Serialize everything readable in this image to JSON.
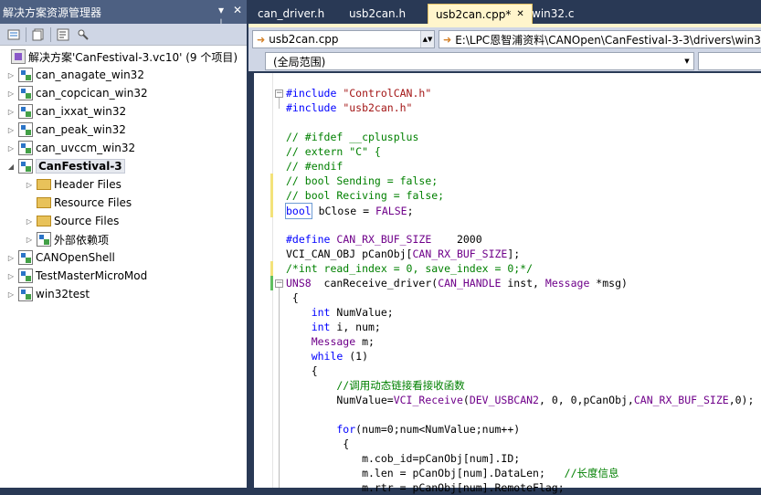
{
  "colors": {
    "accent_tab": "#fff5cc",
    "chrome_dark": "#293955",
    "title_bar": "#4d6082",
    "toolbar": "#cfd6e5",
    "change_yellow": "#f3e27a",
    "change_green": "#5fbf5f"
  },
  "solution_explorer": {
    "title": "解决方案资源管理器",
    "pin_label": "▾ ⊥",
    "close_label": "✕",
    "toolbar_icons": [
      "properties-icon",
      "show-all-files-icon",
      "view-code-icon",
      "class-diagram-icon"
    ],
    "solution_label": "解决方案'CanFestival-3.vc10' (9 个项目)",
    "items": [
      {
        "label": "can_anagate_win32",
        "icon": "project-icon"
      },
      {
        "label": "can_copcican_win32",
        "icon": "project-icon"
      },
      {
        "label": "can_ixxat_win32",
        "icon": "project-icon"
      },
      {
        "label": "can_peak_win32",
        "icon": "project-icon"
      },
      {
        "label": "can_uvccm_win32",
        "icon": "project-icon"
      },
      {
        "label": "CanFestival-3",
        "icon": "project-icon"
      },
      {
        "label": "Header Files",
        "icon": "folder-icon"
      },
      {
        "label": "Resource Files",
        "icon": "folder-icon"
      },
      {
        "label": "Source Files",
        "icon": "folder-icon"
      },
      {
        "label": "外部依赖项",
        "icon": "external-deps-icon"
      },
      {
        "label": "CANOpenShell",
        "icon": "project-icon"
      },
      {
        "label": "TestMasterMicroMod",
        "icon": "project-icon"
      },
      {
        "label": "win32test",
        "icon": "project-icon"
      }
    ]
  },
  "tabs": [
    {
      "label": "can_driver.h"
    },
    {
      "label": "usb2can.h"
    },
    {
      "label": "usb2can.cpp*",
      "close": "✕"
    },
    {
      "label": "win32.c"
    }
  ],
  "nav": {
    "file_combo": "usb2can.cpp",
    "path": "E:\\LPC恩智浦资料\\CANOpen\\CanFestival-3-3\\drivers\\win3",
    "scope": "(全局范围)"
  },
  "code": {
    "l1_kw": "#include",
    "l1_str": " \"ControlCAN.h\"",
    "l2_kw": "#include",
    "l2_str": " \"usb2can.h\"",
    "l4": "// #ifdef __cplusplus",
    "l5": "// extern \"C\" {",
    "l6": "// #endif",
    "l7": "// bool Sending = false;",
    "l8": "// bool Reciving = false;",
    "l9_kw": "bool",
    "l9_mid": " bClose = ",
    "l9_mac": "FALSE",
    "l9_end": ";",
    "l11_kw": "#define",
    "l11_mac": " CAN_RX_BUF_SIZE",
    "l11_val": "    2000",
    "l12_a": "VCI_CAN_OBJ pCanObj[",
    "l12_mac": "CAN_RX_BUF_SIZE",
    "l12_b": "];",
    "l13": "/*int read_index = 0, save_index = 0;*/",
    "l14_mac": "UNS8",
    "l14_b": "  canReceive_driver(",
    "l14_mac2": "CAN_HANDLE",
    "l14_c": " inst, ",
    "l14_mac3": "Message",
    "l14_d": " *msg)",
    "l15": " {",
    "l16_kw": "    int",
    "l16_b": " NumValue;",
    "l17_kw": "    int",
    "l17_b": " i, num;",
    "l18_mac": "    Message",
    "l18_b": " m;",
    "l19_kw": "    while",
    "l19_b": " (1)",
    "l20": "    {",
    "l21": "        //调用动态链接看接收函数",
    "l22_a": "        NumValue=",
    "l22_mac": "VCI_Receive",
    "l22_b": "(",
    "l22_mac2": "DEV_USBCAN2",
    "l22_c": ", 0, 0,pCanObj,",
    "l22_mac3": "CAN_RX_BUF_SIZE",
    "l22_d": ",0);",
    "l24_kw": "        for",
    "l24_b": "(num=0;num<NumValue;num++)",
    "l25": "         {",
    "l26": "            m.cob_id=pCanObj[num].ID;",
    "l27_a": "            m.len = pCanObj[num].DataLen;   ",
    "l27_cm": "//长度信息",
    "l28": "            m.rtr = pCanObj[num].RemoteFlag;"
  }
}
